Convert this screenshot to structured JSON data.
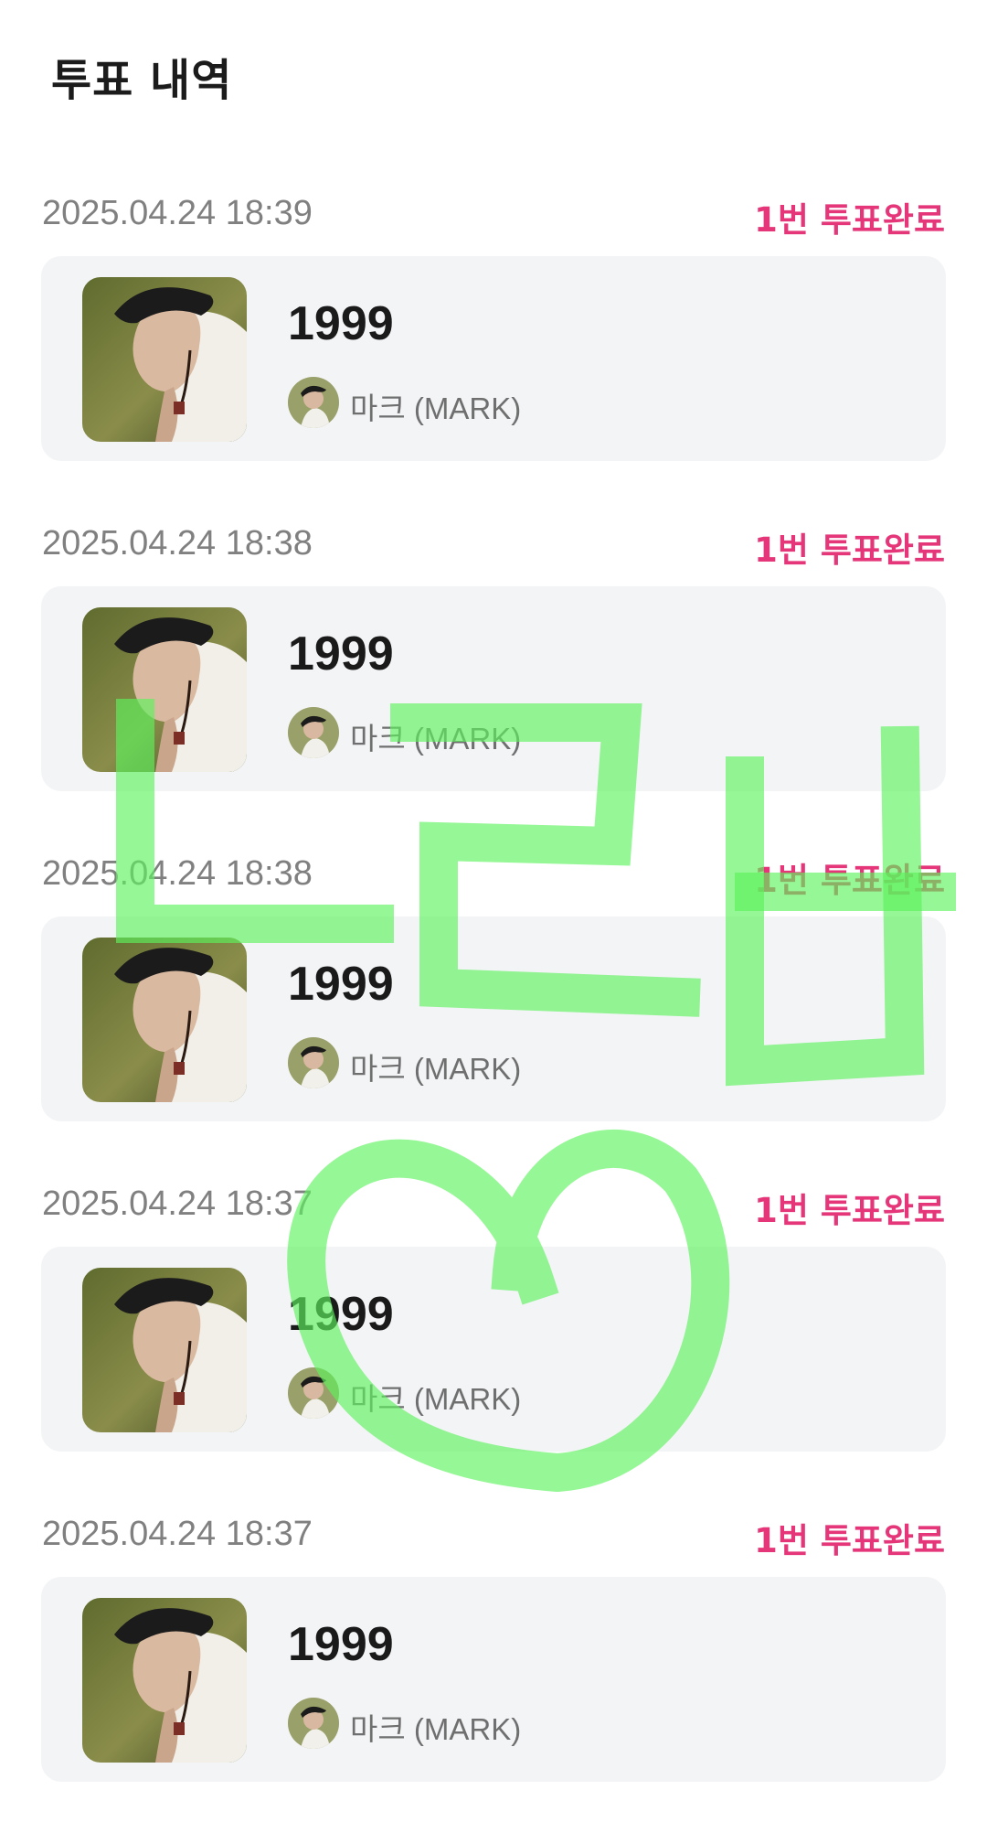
{
  "header": {
    "title": "투표 내역"
  },
  "entries": [
    {
      "timestamp": "2025.04.24 18:39",
      "status": "1번 투표완료",
      "song_title": "1999",
      "artist": "마크 (MARK)"
    },
    {
      "timestamp": "2025.04.24 18:38",
      "status": "1번 투표완료",
      "song_title": "1999",
      "artist": "마크 (MARK)"
    },
    {
      "timestamp": "2025.04.24 18:38",
      "status": "1번 투표완료",
      "song_title": "1999",
      "artist": "마크 (MARK)"
    },
    {
      "timestamp": "2025.04.24 18:37",
      "status": "1번 투표완료",
      "song_title": "1999",
      "artist": "마크 (MARK)"
    },
    {
      "timestamp": "2025.04.24 18:37",
      "status": "1번 투표완료",
      "song_title": "1999",
      "artist": "마크 (MARK)"
    }
  ],
  "colors": {
    "accent_pink": "#e5367a",
    "card_background": "#f3f4f6",
    "doodle_green": "#5cf25c"
  },
  "icons": {
    "album_art": "album-cover-portrait",
    "artist_avatar": "artist-avatar-portrait"
  },
  "overlay": {
    "type": "handwritten-doodle",
    "shape": "hangul-strokes-and-heart"
  }
}
